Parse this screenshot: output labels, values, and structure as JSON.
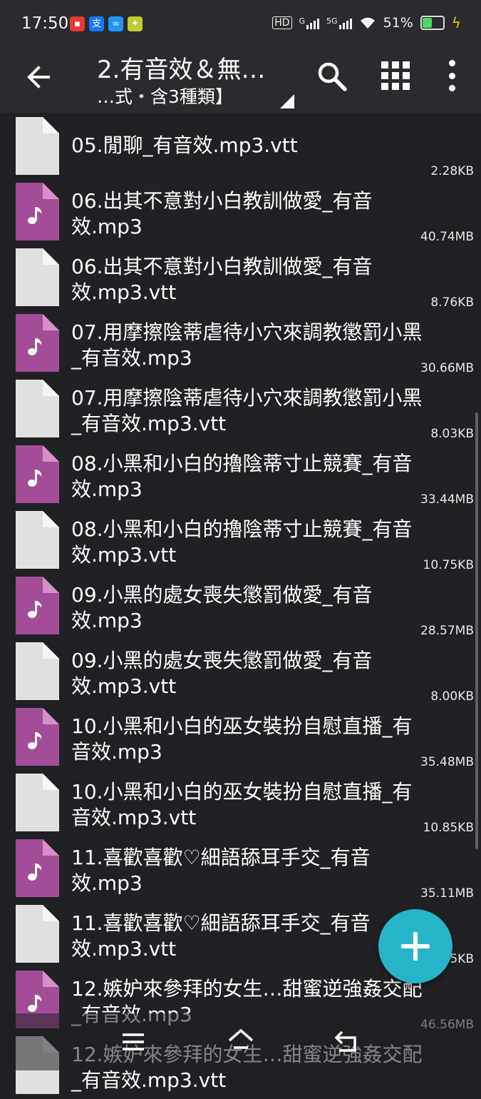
{
  "status_bar": {
    "time": "17:50",
    "apps": [
      {
        "icon": "red-app-icon",
        "glyph": "▪",
        "color": "#e53935"
      },
      {
        "icon": "alipay-icon",
        "glyph": "支",
        "color": "#1677ff"
      },
      {
        "icon": "blue-app-icon",
        "glyph": "∞",
        "color": "#2196f3"
      },
      {
        "icon": "game-app-icon",
        "glyph": "✦",
        "color": "#c0ca33"
      }
    ],
    "hd_label": "HD",
    "net1": "G",
    "net2": "5G",
    "battery_text": "51%",
    "battery_level": 0.51
  },
  "app_bar": {
    "title": "2.有音效＆無…",
    "subtitle": "…式・含3種類】"
  },
  "files": [
    {
      "name": "05.閒聊_有音效.mp3.vtt",
      "size": "2.28KB",
      "type": "doc"
    },
    {
      "name": "06.出其不意對小白教訓做愛_有音效.mp3",
      "size": "40.74MB",
      "type": "audio"
    },
    {
      "name": "06.出其不意對小白教訓做愛_有音效.mp3.vtt",
      "size": "8.76KB",
      "type": "doc"
    },
    {
      "name": "07.用摩擦陰蒂虐待小穴來調教懲罰小黑_有音效.mp3",
      "size": "30.66MB",
      "type": "audio"
    },
    {
      "name": "07.用摩擦陰蒂虐待小穴來調教懲罰小黑_有音效.mp3.vtt",
      "size": "8.03KB",
      "type": "doc"
    },
    {
      "name": "08.小黑和小白的擼陰蒂寸止競賽_有音效.mp3",
      "size": "33.44MB",
      "type": "audio"
    },
    {
      "name": "08.小黑和小白的擼陰蒂寸止競賽_有音效.mp3.vtt",
      "size": "10.75KB",
      "type": "doc"
    },
    {
      "name": "09.小黑的處女喪失懲罰做愛_有音效.mp3",
      "size": "28.57MB",
      "type": "audio"
    },
    {
      "name": "09.小黑的處女喪失懲罰做愛_有音效.mp3.vtt",
      "size": "8.00KB",
      "type": "doc"
    },
    {
      "name": "10.小黑和小白的巫女裝扮自慰直播_有音效.mp3",
      "size": "35.48MB",
      "type": "audio"
    },
    {
      "name": "10.小黑和小白的巫女裝扮自慰直播_有音效.mp3.vtt",
      "size": "10.85KB",
      "type": "doc"
    },
    {
      "name": "11.喜歡喜歡♡細語舔耳手交_有音效.mp3",
      "size": "35.11MB",
      "type": "audio"
    },
    {
      "name": "11.喜歡喜歡♡細語舔耳手交_有音效.mp3.vtt",
      "size": "8.95KB",
      "type": "doc"
    },
    {
      "name": "12.嫉妒來參拜的女生…甜蜜逆強姦交配_有音效.mp3",
      "size": "46.56MB",
      "type": "audio"
    },
    {
      "name": "12.嫉妒來參拜的女生…甜蜜逆強姦交配_有音效.mp3.vtt",
      "size": "",
      "type": "doc"
    }
  ],
  "fab": {
    "icon": "add-icon"
  },
  "colors": {
    "audio_icon": "#a34c98",
    "doc_icon": "#e0e0e0",
    "fab": "#26b4c9",
    "background": "#202124"
  }
}
